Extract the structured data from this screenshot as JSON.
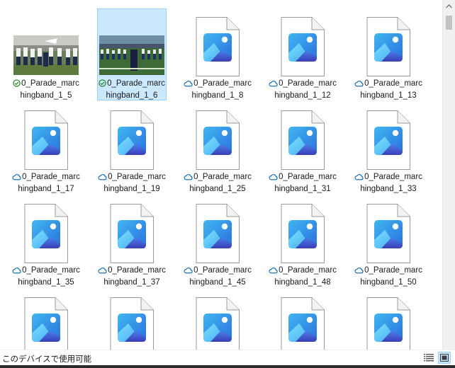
{
  "files": [
    {
      "line1": "0_Parade_marc",
      "line2": "hingband_1_5",
      "status": "synced",
      "thumb": "photo-a",
      "selected": false
    },
    {
      "line1": "0_Parade_marc",
      "line2": "hingband_1_6",
      "status": "synced",
      "thumb": "photo-b",
      "selected": true
    },
    {
      "line1": "0_Parade_marc",
      "line2": "hingband_1_8",
      "status": "cloud",
      "thumb": "image-file",
      "selected": false
    },
    {
      "line1": "0_Parade_marc",
      "line2": "hingband_1_12",
      "status": "cloud",
      "thumb": "image-file",
      "selected": false
    },
    {
      "line1": "0_Parade_marc",
      "line2": "hingband_1_13",
      "status": "cloud",
      "thumb": "image-file",
      "selected": false
    },
    {
      "line1": "0_Parade_marc",
      "line2": "hingband_1_17",
      "status": "cloud",
      "thumb": "image-file",
      "selected": false
    },
    {
      "line1": "0_Parade_marc",
      "line2": "hingband_1_19",
      "status": "cloud",
      "thumb": "image-file",
      "selected": false
    },
    {
      "line1": "0_Parade_marc",
      "line2": "hingband_1_25",
      "status": "cloud",
      "thumb": "image-file",
      "selected": false
    },
    {
      "line1": "0_Parade_marc",
      "line2": "hingband_1_31",
      "status": "cloud",
      "thumb": "image-file",
      "selected": false
    },
    {
      "line1": "0_Parade_marc",
      "line2": "hingband_1_33",
      "status": "cloud",
      "thumb": "image-file",
      "selected": false
    },
    {
      "line1": "0_Parade_marc",
      "line2": "hingband_1_35",
      "status": "cloud",
      "thumb": "image-file",
      "selected": false
    },
    {
      "line1": "0_Parade_marc",
      "line2": "hingband_1_37",
      "status": "cloud",
      "thumb": "image-file",
      "selected": false
    },
    {
      "line1": "0_Parade_marc",
      "line2": "hingband_1_45",
      "status": "cloud",
      "thumb": "image-file",
      "selected": false
    },
    {
      "line1": "0_Parade_marc",
      "line2": "hingband_1_48",
      "status": "cloud",
      "thumb": "image-file",
      "selected": false
    },
    {
      "line1": "0_Parade_marc",
      "line2": "hingband_1_50",
      "status": "cloud",
      "thumb": "image-file",
      "selected": false
    },
    {
      "line1": "",
      "line2": "",
      "status": "none",
      "thumb": "image-file",
      "selected": false
    },
    {
      "line1": "",
      "line2": "",
      "status": "none",
      "thumb": "image-file",
      "selected": false
    },
    {
      "line1": "",
      "line2": "",
      "status": "none",
      "thumb": "image-file",
      "selected": false
    },
    {
      "line1": "",
      "line2": "",
      "status": "none",
      "thumb": "image-file",
      "selected": false
    },
    {
      "line1": "",
      "line2": "",
      "status": "none",
      "thumb": "image-file",
      "selected": false
    }
  ],
  "statusbar": {
    "text": "このデバイスで使用可能",
    "details_view_icon": "details-view-icon",
    "large_icons_view_icon": "large-icons-view-icon"
  },
  "colors": {
    "selection_bg": "#cce8ff",
    "selection_border": "#99d1ff",
    "synced_green": "#107c10",
    "cloud_blue": "#0063b1",
    "icon_blue_light": "#5bc8f5",
    "icon_blue_dark": "#2b66d6",
    "icon_purple": "#4a3fbf"
  }
}
